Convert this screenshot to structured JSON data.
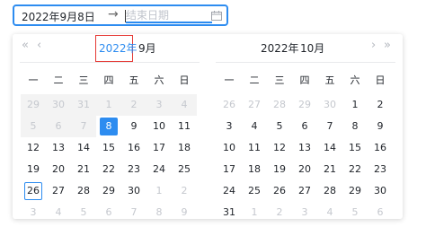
{
  "range_input": {
    "start_value": "2022年9月8日",
    "separator": "→",
    "end_placeholder": "结束日期",
    "calendar_icon": "calendar-icon"
  },
  "left_panel": {
    "year": "2022年",
    "month": "9月",
    "nav_prev_year": "«",
    "nav_prev_month": "‹"
  },
  "right_panel": {
    "year": "2022年",
    "month": "10月",
    "nav_next_month": "›",
    "nav_next_year": "»"
  },
  "weekdays": [
    "一",
    "二",
    "三",
    "四",
    "五",
    "六",
    "日"
  ],
  "left_weeks": [
    [
      {
        "d": "29",
        "s": "disabled"
      },
      {
        "d": "30",
        "s": "disabled"
      },
      {
        "d": "31",
        "s": "disabled"
      },
      {
        "d": "1",
        "s": "disabled"
      },
      {
        "d": "2",
        "s": "disabled"
      },
      {
        "d": "3",
        "s": "disabled"
      },
      {
        "d": "4",
        "s": "disabled"
      }
    ],
    [
      {
        "d": "5",
        "s": "disabled"
      },
      {
        "d": "6",
        "s": "disabled"
      },
      {
        "d": "7",
        "s": "disabled"
      },
      {
        "d": "8",
        "s": "selected"
      },
      {
        "d": "9",
        "s": ""
      },
      {
        "d": "10",
        "s": ""
      },
      {
        "d": "11",
        "s": ""
      }
    ],
    [
      {
        "d": "12",
        "s": ""
      },
      {
        "d": "13",
        "s": ""
      },
      {
        "d": "14",
        "s": ""
      },
      {
        "d": "15",
        "s": ""
      },
      {
        "d": "16",
        "s": ""
      },
      {
        "d": "17",
        "s": ""
      },
      {
        "d": "18",
        "s": ""
      }
    ],
    [
      {
        "d": "19",
        "s": ""
      },
      {
        "d": "20",
        "s": ""
      },
      {
        "d": "21",
        "s": ""
      },
      {
        "d": "22",
        "s": ""
      },
      {
        "d": "23",
        "s": ""
      },
      {
        "d": "24",
        "s": ""
      },
      {
        "d": "25",
        "s": ""
      }
    ],
    [
      {
        "d": "26",
        "s": "today"
      },
      {
        "d": "27",
        "s": ""
      },
      {
        "d": "28",
        "s": ""
      },
      {
        "d": "29",
        "s": ""
      },
      {
        "d": "30",
        "s": ""
      },
      {
        "d": "1",
        "s": "muted"
      },
      {
        "d": "2",
        "s": "muted"
      }
    ],
    [
      {
        "d": "3",
        "s": "muted"
      },
      {
        "d": "4",
        "s": "muted"
      },
      {
        "d": "5",
        "s": "muted"
      },
      {
        "d": "6",
        "s": "muted"
      },
      {
        "d": "7",
        "s": "muted"
      },
      {
        "d": "8",
        "s": "muted"
      },
      {
        "d": "9",
        "s": "muted"
      }
    ]
  ],
  "right_weeks": [
    [
      {
        "d": "26",
        "s": "muted"
      },
      {
        "d": "27",
        "s": "muted"
      },
      {
        "d": "28",
        "s": "muted"
      },
      {
        "d": "29",
        "s": "muted"
      },
      {
        "d": "30",
        "s": "muted"
      },
      {
        "d": "1",
        "s": ""
      },
      {
        "d": "2",
        "s": ""
      }
    ],
    [
      {
        "d": "3",
        "s": ""
      },
      {
        "d": "4",
        "s": ""
      },
      {
        "d": "5",
        "s": ""
      },
      {
        "d": "6",
        "s": ""
      },
      {
        "d": "7",
        "s": ""
      },
      {
        "d": "8",
        "s": ""
      },
      {
        "d": "9",
        "s": ""
      }
    ],
    [
      {
        "d": "10",
        "s": ""
      },
      {
        "d": "11",
        "s": ""
      },
      {
        "d": "12",
        "s": ""
      },
      {
        "d": "13",
        "s": ""
      },
      {
        "d": "14",
        "s": ""
      },
      {
        "d": "15",
        "s": ""
      },
      {
        "d": "16",
        "s": ""
      }
    ],
    [
      {
        "d": "17",
        "s": ""
      },
      {
        "d": "18",
        "s": ""
      },
      {
        "d": "19",
        "s": ""
      },
      {
        "d": "20",
        "s": ""
      },
      {
        "d": "21",
        "s": ""
      },
      {
        "d": "22",
        "s": ""
      },
      {
        "d": "23",
        "s": ""
      }
    ],
    [
      {
        "d": "24",
        "s": ""
      },
      {
        "d": "25",
        "s": ""
      },
      {
        "d": "26",
        "s": ""
      },
      {
        "d": "27",
        "s": ""
      },
      {
        "d": "28",
        "s": ""
      },
      {
        "d": "29",
        "s": ""
      },
      {
        "d": "30",
        "s": ""
      }
    ],
    [
      {
        "d": "31",
        "s": ""
      },
      {
        "d": "1",
        "s": "muted"
      },
      {
        "d": "2",
        "s": "muted"
      },
      {
        "d": "3",
        "s": "muted"
      },
      {
        "d": "4",
        "s": "muted"
      },
      {
        "d": "5",
        "s": "muted"
      },
      {
        "d": "6",
        "s": "muted"
      }
    ]
  ],
  "colors": {
    "accent": "#2d8cf0",
    "highlight_border": "#e53935",
    "muted_text": "#c5c8ce",
    "disabled_bg": "#f3f3f3"
  }
}
